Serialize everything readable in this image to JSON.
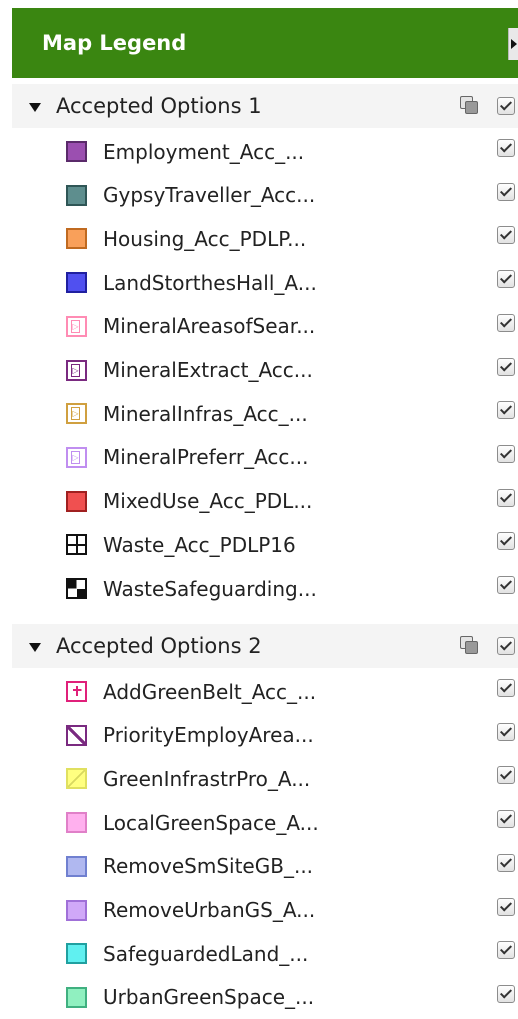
{
  "header": {
    "title": "Map Legend"
  },
  "groups": [
    {
      "title": "Accepted Options 1",
      "items": [
        {
          "label": "Employment_Acc_...",
          "fill": "#9b4fb0",
          "border": "#5a2a6a",
          "style": "solid"
        },
        {
          "label": "GypsyTraveller_Acc...",
          "fill": "#5e8e8e",
          "border": "#2f5656",
          "style": "solid"
        },
        {
          "label": "Housing_Acc_PDLP...",
          "fill": "#f9a05a",
          "border": "#c06a20",
          "style": "solid"
        },
        {
          "label": "LandStorthesHall_A...",
          "fill": "#5050f0",
          "border": "#2020a0",
          "style": "solid"
        },
        {
          "label": "MineralAreasofSear...",
          "fill": "#ffffff",
          "border": "#ff8cb4",
          "style": "mineral"
        },
        {
          "label": "MineralExtract_Acc...",
          "fill": "#ffffff",
          "border": "#7a2a80",
          "style": "mineral"
        },
        {
          "label": "MineralInfras_Acc_...",
          "fill": "#ffffff",
          "border": "#d0a040",
          "style": "mineral"
        },
        {
          "label": "MineralPreferr_Acc...",
          "fill": "#ffffff",
          "border": "#c08ef0",
          "style": "mineral"
        },
        {
          "label": "MixedUse_Acc_PDL...",
          "fill": "#f05050",
          "border": "#a02020",
          "style": "solid"
        },
        {
          "label": "Waste_Acc_PDLP16",
          "fill": "#ffffff",
          "border": "#111111",
          "style": "grid"
        },
        {
          "label": "WasteSafeguarding...",
          "fill": "#ffffff",
          "border": "#111111",
          "style": "checker"
        }
      ]
    },
    {
      "title": "Accepted Options 2",
      "items": [
        {
          "label": "AddGreenBelt_Acc_...",
          "fill": "#ffffff",
          "border": "#e0207a",
          "style": "cross"
        },
        {
          "label": "PriorityEmployArea...",
          "fill": "#ffffff",
          "border": "#7a2a80",
          "style": "diagonal"
        },
        {
          "label": "GreenInfrastrPro_A...",
          "fill": "#ffff80",
          "border": "#e0e060",
          "style": "diagonal-light"
        },
        {
          "label": "LocalGreenSpace_A...",
          "fill": "#ffb0ee",
          "border": "#e080c8",
          "style": "solid"
        },
        {
          "label": "RemoveSmSiteGB_...",
          "fill": "#b0b8f0",
          "border": "#7080d0",
          "style": "solid"
        },
        {
          "label": "RemoveUrbanGS_A...",
          "fill": "#d0a8f8",
          "border": "#a070d8",
          "style": "solid"
        },
        {
          "label": "SafeguardedLand_...",
          "fill": "#60f0f0",
          "border": "#20a0a0",
          "style": "solid"
        },
        {
          "label": "UrbanGreenSpace_...",
          "fill": "#90f0c0",
          "border": "#40b080",
          "style": "solid"
        }
      ]
    }
  ]
}
